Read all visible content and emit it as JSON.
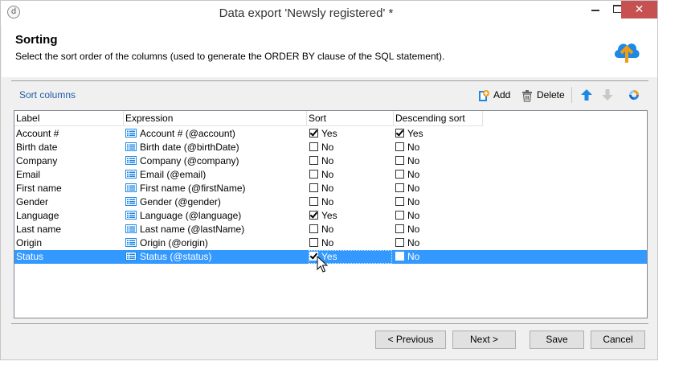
{
  "window": {
    "title": "Data export 'Newsly registered' *"
  },
  "header": {
    "title": "Sorting",
    "description": "Select the sort order of the columns (used to generate the ORDER BY clause of the SQL statement)."
  },
  "toolbar": {
    "section_label": "Sort columns",
    "add_label": "Add",
    "delete_label": "Delete"
  },
  "grid": {
    "columns": [
      "Label",
      "Expression",
      "Sort",
      "Descending sort"
    ],
    "rows": [
      {
        "label": "Account #",
        "expression": "Account # (@account)",
        "sort": true,
        "sort_text": "Yes",
        "desc": true,
        "desc_text": "Yes"
      },
      {
        "label": "Birth date",
        "expression": "Birth date (@birthDate)",
        "sort": false,
        "sort_text": "No",
        "desc": false,
        "desc_text": "No"
      },
      {
        "label": "Company",
        "expression": "Company (@company)",
        "sort": false,
        "sort_text": "No",
        "desc": false,
        "desc_text": "No"
      },
      {
        "label": "Email",
        "expression": "Email (@email)",
        "sort": false,
        "sort_text": "No",
        "desc": false,
        "desc_text": "No"
      },
      {
        "label": "First name",
        "expression": "First name (@firstName)",
        "sort": false,
        "sort_text": "No",
        "desc": false,
        "desc_text": "No"
      },
      {
        "label": "Gender",
        "expression": "Gender (@gender)",
        "sort": false,
        "sort_text": "No",
        "desc": false,
        "desc_text": "No"
      },
      {
        "label": "Language",
        "expression": "Language (@language)",
        "sort": true,
        "sort_text": "Yes",
        "desc": false,
        "desc_text": "No"
      },
      {
        "label": "Last name",
        "expression": "Last name (@lastName)",
        "sort": false,
        "sort_text": "No",
        "desc": false,
        "desc_text": "No"
      },
      {
        "label": "Origin",
        "expression": "Origin (@origin)",
        "sort": false,
        "sort_text": "No",
        "desc": false,
        "desc_text": "No"
      },
      {
        "label": "Status",
        "expression": "Status (@status)",
        "sort": true,
        "sort_text": "Yes",
        "desc": false,
        "desc_text": "No",
        "selected": true
      }
    ]
  },
  "footer": {
    "previous_label": "< Previous",
    "next_label": "Next >",
    "save_label": "Save",
    "cancel_label": "Cancel"
  },
  "icons": {
    "app": "app-icon",
    "header": "cloud-upload-icon",
    "add": "add-icon",
    "delete": "trash-icon",
    "move_up": "arrow-up-icon",
    "move_down": "arrow-down-icon",
    "refresh": "refresh-icon",
    "expression": "list-icon"
  },
  "colors": {
    "selection": "#3399ff",
    "link": "#1f5ca8",
    "close_button": "#c75050",
    "accent_orange": "#f39c12",
    "accent_blue": "#1e88e5"
  }
}
